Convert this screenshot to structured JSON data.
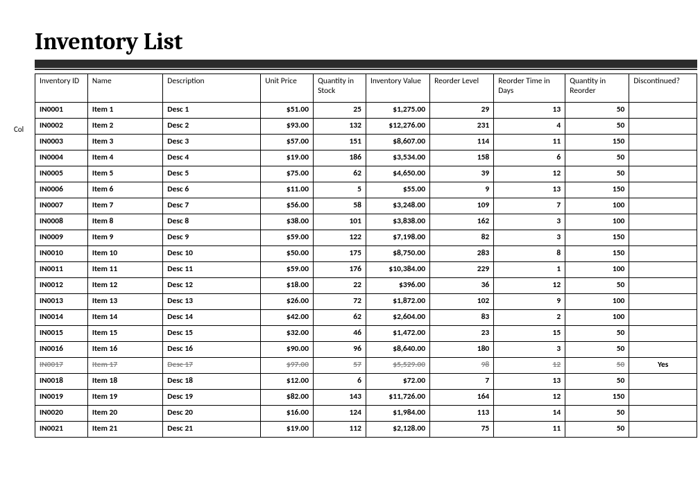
{
  "title": "Inventory List",
  "sideLabel": "Col",
  "headers": {
    "id": "Inventory ID",
    "name": "Name",
    "desc": "Description",
    "up": "Unit Price",
    "qis": "Quantity in Stock",
    "iv": "Inventory Value",
    "rl": "Reorder Level",
    "rtd": "Reorder Time in Days",
    "qir": "Quantity in Reorder",
    "disc": "Discontinued?"
  },
  "rows": [
    {
      "id": "IN0001",
      "name": "Item 1",
      "desc": "Desc 1",
      "up": "$51.00",
      "qis": "25",
      "iv": "$1,275.00",
      "rl": "29",
      "rtd": "13",
      "qir": "50",
      "disc": "",
      "discontinued": false
    },
    {
      "id": "IN0002",
      "name": "Item 2",
      "desc": "Desc 2",
      "up": "$93.00",
      "qis": "132",
      "iv": "$12,276.00",
      "rl": "231",
      "rtd": "4",
      "qir": "50",
      "disc": "",
      "discontinued": false
    },
    {
      "id": "IN0003",
      "name": "Item 3",
      "desc": "Desc 3",
      "up": "$57.00",
      "qis": "151",
      "iv": "$8,607.00",
      "rl": "114",
      "rtd": "11",
      "qir": "150",
      "disc": "",
      "discontinued": false
    },
    {
      "id": "IN0004",
      "name": "Item 4",
      "desc": "Desc 4",
      "up": "$19.00",
      "qis": "186",
      "iv": "$3,534.00",
      "rl": "158",
      "rtd": "6",
      "qir": "50",
      "disc": "",
      "discontinued": false
    },
    {
      "id": "IN0005",
      "name": "Item 5",
      "desc": "Desc 5",
      "up": "$75.00",
      "qis": "62",
      "iv": "$4,650.00",
      "rl": "39",
      "rtd": "12",
      "qir": "50",
      "disc": "",
      "discontinued": false
    },
    {
      "id": "IN0006",
      "name": "Item 6",
      "desc": "Desc 6",
      "up": "$11.00",
      "qis": "5",
      "iv": "$55.00",
      "rl": "9",
      "rtd": "13",
      "qir": "150",
      "disc": "",
      "discontinued": false
    },
    {
      "id": "IN0007",
      "name": "Item 7",
      "desc": "Desc 7",
      "up": "$56.00",
      "qis": "58",
      "iv": "$3,248.00",
      "rl": "109",
      "rtd": "7",
      "qir": "100",
      "disc": "",
      "discontinued": false
    },
    {
      "id": "IN0008",
      "name": "Item 8",
      "desc": "Desc 8",
      "up": "$38.00",
      "qis": "101",
      "iv": "$3,838.00",
      "rl": "162",
      "rtd": "3",
      "qir": "100",
      "disc": "",
      "discontinued": false
    },
    {
      "id": "IN0009",
      "name": "Item 9",
      "desc": "Desc 9",
      "up": "$59.00",
      "qis": "122",
      "iv": "$7,198.00",
      "rl": "82",
      "rtd": "3",
      "qir": "150",
      "disc": "",
      "discontinued": false
    },
    {
      "id": "IN0010",
      "name": "Item 10",
      "desc": "Desc 10",
      "up": "$50.00",
      "qis": "175",
      "iv": "$8,750.00",
      "rl": "283",
      "rtd": "8",
      "qir": "150",
      "disc": "",
      "discontinued": false
    },
    {
      "id": "IN0011",
      "name": "Item 11",
      "desc": "Desc 11",
      "up": "$59.00",
      "qis": "176",
      "iv": "$10,384.00",
      "rl": "229",
      "rtd": "1",
      "qir": "100",
      "disc": "",
      "discontinued": false
    },
    {
      "id": "IN0012",
      "name": "Item 12",
      "desc": "Desc 12",
      "up": "$18.00",
      "qis": "22",
      "iv": "$396.00",
      "rl": "36",
      "rtd": "12",
      "qir": "50",
      "disc": "",
      "discontinued": false
    },
    {
      "id": "IN0013",
      "name": "Item 13",
      "desc": "Desc 13",
      "up": "$26.00",
      "qis": "72",
      "iv": "$1,872.00",
      "rl": "102",
      "rtd": "9",
      "qir": "100",
      "disc": "",
      "discontinued": false
    },
    {
      "id": "IN0014",
      "name": "Item 14",
      "desc": "Desc 14",
      "up": "$42.00",
      "qis": "62",
      "iv": "$2,604.00",
      "rl": "83",
      "rtd": "2",
      "qir": "100",
      "disc": "",
      "discontinued": false
    },
    {
      "id": "IN0015",
      "name": "Item 15",
      "desc": "Desc 15",
      "up": "$32.00",
      "qis": "46",
      "iv": "$1,472.00",
      "rl": "23",
      "rtd": "15",
      "qir": "50",
      "disc": "",
      "discontinued": false
    },
    {
      "id": "IN0016",
      "name": "Item 16",
      "desc": "Desc 16",
      "up": "$90.00",
      "qis": "96",
      "iv": "$8,640.00",
      "rl": "180",
      "rtd": "3",
      "qir": "50",
      "disc": "",
      "discontinued": false
    },
    {
      "id": "IN0017",
      "name": "Item 17",
      "desc": "Desc 17",
      "up": "$97.00",
      "qis": "57",
      "iv": "$5,529.00",
      "rl": "98",
      "rtd": "12",
      "qir": "50",
      "disc": "Yes",
      "discontinued": true
    },
    {
      "id": "IN0018",
      "name": "Item 18",
      "desc": "Desc 18",
      "up": "$12.00",
      "qis": "6",
      "iv": "$72.00",
      "rl": "7",
      "rtd": "13",
      "qir": "50",
      "disc": "",
      "discontinued": false
    },
    {
      "id": "IN0019",
      "name": "Item 19",
      "desc": "Desc 19",
      "up": "$82.00",
      "qis": "143",
      "iv": "$11,726.00",
      "rl": "164",
      "rtd": "12",
      "qir": "150",
      "disc": "",
      "discontinued": false
    },
    {
      "id": "IN0020",
      "name": "Item 20",
      "desc": "Desc 20",
      "up": "$16.00",
      "qis": "124",
      "iv": "$1,984.00",
      "rl": "113",
      "rtd": "14",
      "qir": "50",
      "disc": "",
      "discontinued": false
    },
    {
      "id": "IN0021",
      "name": "Item 21",
      "desc": "Desc 21",
      "up": "$19.00",
      "qis": "112",
      "iv": "$2,128.00",
      "rl": "75",
      "rtd": "11",
      "qir": "50",
      "disc": "",
      "discontinued": false
    }
  ]
}
